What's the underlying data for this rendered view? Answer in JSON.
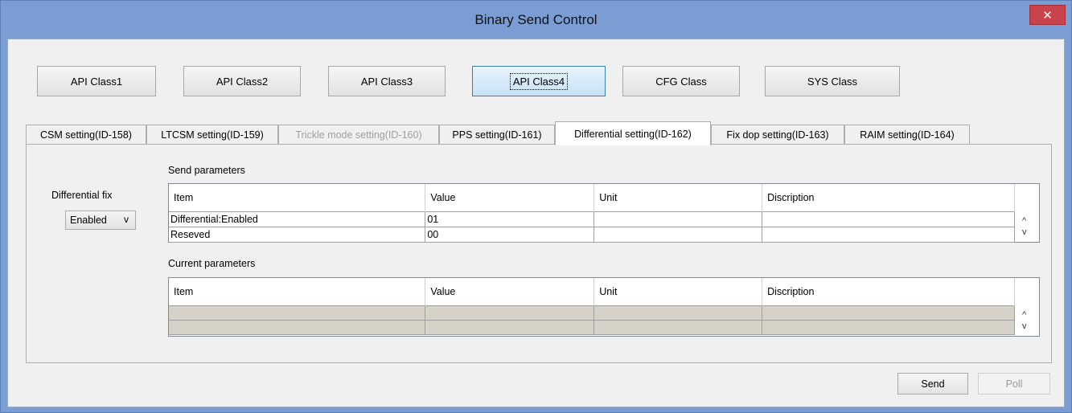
{
  "window": {
    "title": "Binary Send Control",
    "close_glyph": "✕"
  },
  "class_buttons": [
    {
      "label": "API Class1"
    },
    {
      "label": "API Class2"
    },
    {
      "label": "API Class3"
    },
    {
      "label": "API Class4",
      "active": true
    },
    {
      "label": "CFG Class"
    },
    {
      "label": "SYS Class"
    }
  ],
  "tabs": [
    {
      "label": "CSM setting(ID-158)"
    },
    {
      "label": "LTCSM setting(ID-159)"
    },
    {
      "label": "Trickle mode setting(ID-160)",
      "disabled": true
    },
    {
      "label": "PPS setting(ID-161)"
    },
    {
      "label": "Differential setting(ID-162)",
      "active": true
    },
    {
      "label": "Fix dop setting(ID-163)"
    },
    {
      "label": "RAIM setting(ID-164)"
    }
  ],
  "panel": {
    "differential_fix_label": "Differential fix",
    "differential_fix_value": "Enabled",
    "send_parameters_label": "Send parameters",
    "current_parameters_label": "Current parameters"
  },
  "columns": [
    "Item",
    "Value",
    "Unit",
    "Discription"
  ],
  "send_rows": [
    {
      "item": "Differential:Enabled",
      "value": "01",
      "unit": "",
      "description": ""
    },
    {
      "item": "Reseved",
      "value": "00",
      "unit": "",
      "description": ""
    }
  ],
  "current_rows": [
    {
      "item": "",
      "value": "",
      "unit": "",
      "description": ""
    },
    {
      "item": "",
      "value": "",
      "unit": "",
      "description": ""
    }
  ],
  "scroll_glyphs": {
    "up": "^",
    "down": "v"
  },
  "combo_chevron": "v",
  "buttons": {
    "send": "Send",
    "poll": "Poll"
  }
}
